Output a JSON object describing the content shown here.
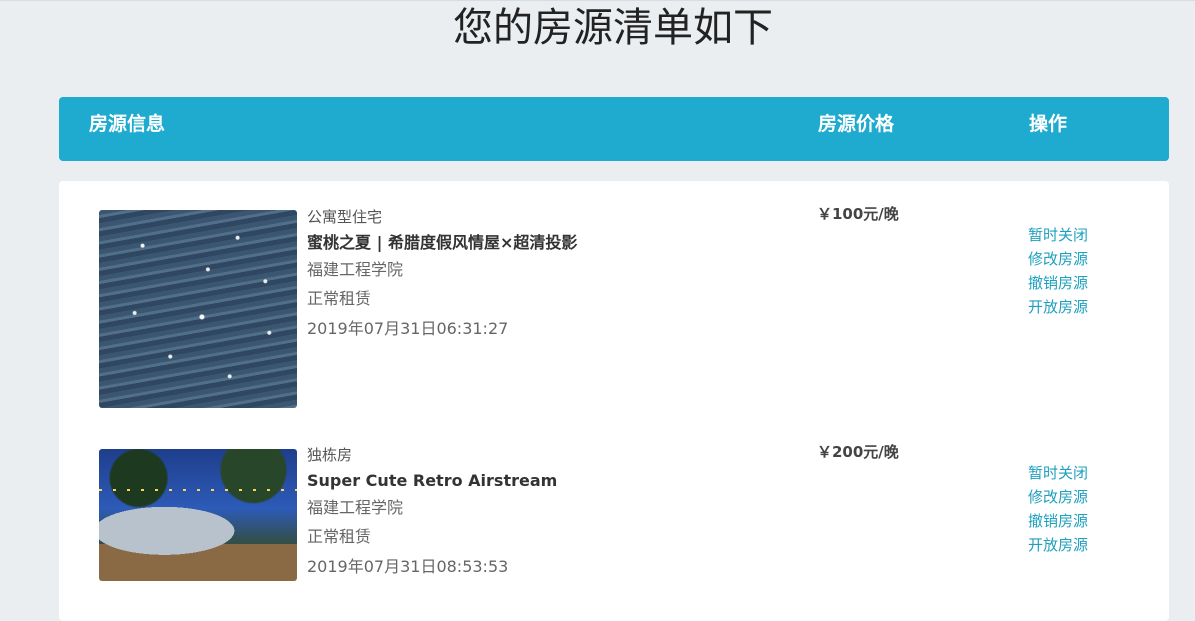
{
  "page": {
    "title": "您的房源清单如下"
  },
  "header": {
    "info_label": "房源信息",
    "price_label": "房源价格",
    "ops_label": "操作"
  },
  "listings": [
    {
      "type": "公寓型住宅",
      "title": "蜜桃之夏 | 希腊度假风情屋×超清投影",
      "address": "福建工程学院",
      "status": "正常租赁",
      "time": "2019年07月31日06:31:27",
      "price": "￥100元/晚",
      "actions": [
        "暂时关闭",
        "修改房源",
        "撤销房源",
        "开放房源"
      ]
    },
    {
      "type": "独栋房",
      "title": "Super Cute Retro Airstream",
      "address": "福建工程学院",
      "status": "正常租赁",
      "time": "2019年07月31日08:53:53",
      "price": "￥200元/晚",
      "actions": [
        "暂时关闭",
        "修改房源",
        "撤销房源",
        "开放房源"
      ]
    }
  ],
  "colors": {
    "accent": "#1eabcf",
    "link": "#1ea0be",
    "background": "#ebeef1"
  }
}
